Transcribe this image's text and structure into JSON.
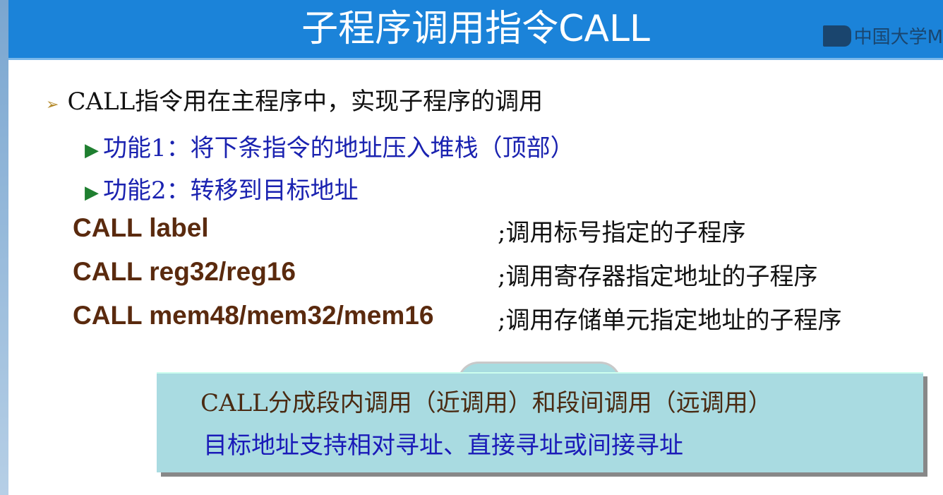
{
  "header": {
    "title": "子程序调用指令CALL",
    "watermark": "中国大学M"
  },
  "bullets": {
    "main": "CALL指令用在主程序中，实现子程序的调用",
    "sub": [
      "功能1：将下条指令的地址压入堆栈（顶部）",
      "功能2：转移到目标地址"
    ]
  },
  "code_lines": [
    {
      "code": "CALL label",
      "comment": ";调用标号指定的子程序"
    },
    {
      "code": "CALL reg32/reg16",
      "comment": ";调用寄存器指定地址的子程序"
    },
    {
      "code": "CALL mem48/mem32/mem16",
      "comment": ";调用存储单元指定地址的子程序"
    }
  ],
  "note": {
    "line1": "CALL分成段内调用（近调用）和段间调用（远调用）",
    "line2": "目标地址支持相对寻址、直接寻址或间接寻址"
  }
}
